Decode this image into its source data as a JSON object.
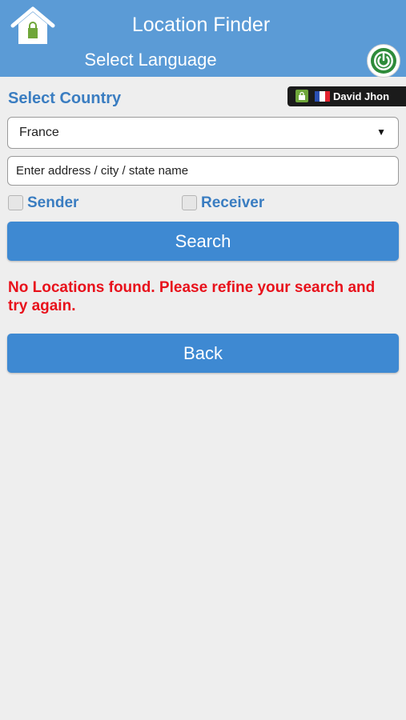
{
  "header": {
    "title": "Location Finder",
    "language_link": "Select Language",
    "home_icon": "home-icon",
    "power_icon": "power-icon"
  },
  "user": {
    "name": "David Jhon",
    "lock_icon": "lock-icon",
    "flag": "france-flag-icon"
  },
  "form": {
    "country_label": "Select Country",
    "country_selected": "France",
    "address_placeholder": "Enter address / city / state name",
    "sender_label": "Sender",
    "receiver_label": "Receiver",
    "search_button": "Search"
  },
  "result": {
    "error_message": "No Locations found. Please refine your search and try again."
  },
  "back_button": "Back",
  "colors": {
    "header": "#5b9bd6",
    "accent": "#3e89d2",
    "label_blue": "#3a7dc1",
    "error_red": "#e8111b",
    "background": "#eeeeee"
  }
}
